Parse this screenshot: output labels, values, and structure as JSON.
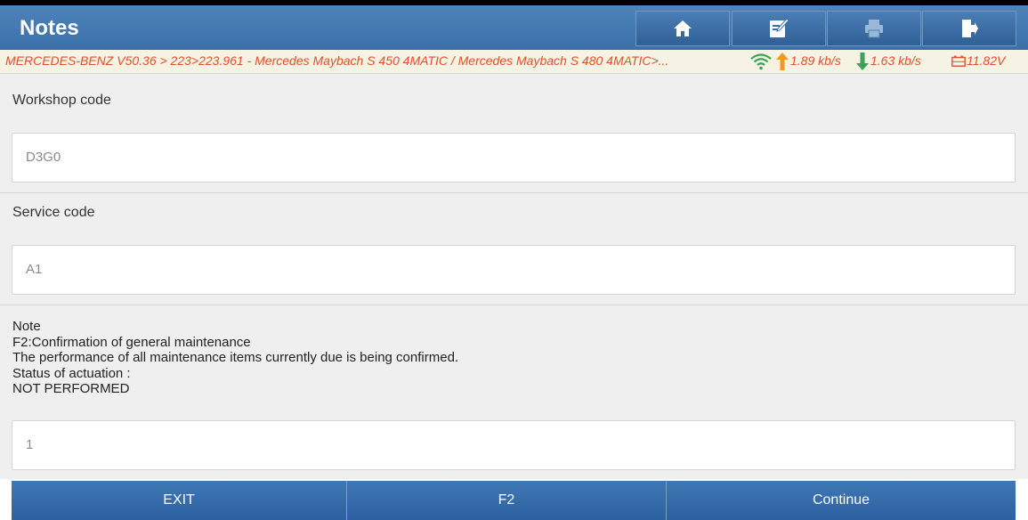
{
  "header": {
    "title": "Notes",
    "toolbar": [
      {
        "icon": "home-icon"
      },
      {
        "icon": "edit-icon"
      },
      {
        "icon": "print-icon"
      },
      {
        "icon": "exit-door-icon"
      }
    ]
  },
  "infobar": {
    "path": "MERCEDES-BENZ V50.36 > 223>223.961 - Mercedes Maybach S 450 4MATIC / Mercedes Maybach S 480 4MATIC>...",
    "upload_speed": "1.89 kb/s",
    "download_speed": "1.63 kb/s",
    "voltage": "11.82V"
  },
  "fields": {
    "workshop_code_label": "Workshop code",
    "workshop_code_value": "D3G0",
    "service_code_label": "Service code",
    "service_code_value": "A1",
    "note_value": "1"
  },
  "note": {
    "line1": "Note",
    "line2": "F2:Confirmation of general maintenance",
    "line3": "The performance of all maintenance items currently due is being confirmed.",
    "line4": "Status of actuation :",
    "line5": "NOT PERFORMED"
  },
  "footer": {
    "exit_label": "EXIT",
    "f2_label": "F2",
    "continue_label": "Continue"
  },
  "colors": {
    "header_blue": "#3a6fa8",
    "infobar_text": "#e0502a",
    "upload_arrow": "#f39a1e",
    "download_arrow": "#3aa35a",
    "wifi": "#3aa35a"
  }
}
